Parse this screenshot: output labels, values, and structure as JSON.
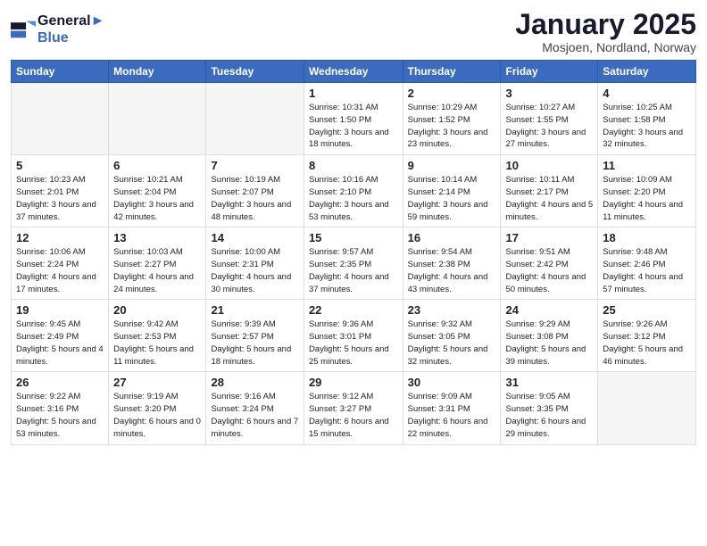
{
  "header": {
    "logo_line1": "General",
    "logo_line2": "Blue",
    "month": "January 2025",
    "location": "Mosjoen, Nordland, Norway"
  },
  "days_of_week": [
    "Sunday",
    "Monday",
    "Tuesday",
    "Wednesday",
    "Thursday",
    "Friday",
    "Saturday"
  ],
  "weeks": [
    [
      {
        "day": "",
        "empty": true
      },
      {
        "day": "",
        "empty": true
      },
      {
        "day": "",
        "empty": true
      },
      {
        "day": "1",
        "sunrise": "10:31 AM",
        "sunset": "1:50 PM",
        "daylight": "3 hours and 18 minutes."
      },
      {
        "day": "2",
        "sunrise": "10:29 AM",
        "sunset": "1:52 PM",
        "daylight": "3 hours and 23 minutes."
      },
      {
        "day": "3",
        "sunrise": "10:27 AM",
        "sunset": "1:55 PM",
        "daylight": "3 hours and 27 minutes."
      },
      {
        "day": "4",
        "sunrise": "10:25 AM",
        "sunset": "1:58 PM",
        "daylight": "3 hours and 32 minutes."
      }
    ],
    [
      {
        "day": "5",
        "sunrise": "10:23 AM",
        "sunset": "2:01 PM",
        "daylight": "3 hours and 37 minutes."
      },
      {
        "day": "6",
        "sunrise": "10:21 AM",
        "sunset": "2:04 PM",
        "daylight": "3 hours and 42 minutes."
      },
      {
        "day": "7",
        "sunrise": "10:19 AM",
        "sunset": "2:07 PM",
        "daylight": "3 hours and 48 minutes."
      },
      {
        "day": "8",
        "sunrise": "10:16 AM",
        "sunset": "2:10 PM",
        "daylight": "3 hours and 53 minutes."
      },
      {
        "day": "9",
        "sunrise": "10:14 AM",
        "sunset": "2:14 PM",
        "daylight": "3 hours and 59 minutes."
      },
      {
        "day": "10",
        "sunrise": "10:11 AM",
        "sunset": "2:17 PM",
        "daylight": "4 hours and 5 minutes."
      },
      {
        "day": "11",
        "sunrise": "10:09 AM",
        "sunset": "2:20 PM",
        "daylight": "4 hours and 11 minutes."
      }
    ],
    [
      {
        "day": "12",
        "sunrise": "10:06 AM",
        "sunset": "2:24 PM",
        "daylight": "4 hours and 17 minutes."
      },
      {
        "day": "13",
        "sunrise": "10:03 AM",
        "sunset": "2:27 PM",
        "daylight": "4 hours and 24 minutes."
      },
      {
        "day": "14",
        "sunrise": "10:00 AM",
        "sunset": "2:31 PM",
        "daylight": "4 hours and 30 minutes."
      },
      {
        "day": "15",
        "sunrise": "9:57 AM",
        "sunset": "2:35 PM",
        "daylight": "4 hours and 37 minutes."
      },
      {
        "day": "16",
        "sunrise": "9:54 AM",
        "sunset": "2:38 PM",
        "daylight": "4 hours and 43 minutes."
      },
      {
        "day": "17",
        "sunrise": "9:51 AM",
        "sunset": "2:42 PM",
        "daylight": "4 hours and 50 minutes."
      },
      {
        "day": "18",
        "sunrise": "9:48 AM",
        "sunset": "2:46 PM",
        "daylight": "4 hours and 57 minutes."
      }
    ],
    [
      {
        "day": "19",
        "sunrise": "9:45 AM",
        "sunset": "2:49 PM",
        "daylight": "5 hours and 4 minutes."
      },
      {
        "day": "20",
        "sunrise": "9:42 AM",
        "sunset": "2:53 PM",
        "daylight": "5 hours and 11 minutes."
      },
      {
        "day": "21",
        "sunrise": "9:39 AM",
        "sunset": "2:57 PM",
        "daylight": "5 hours and 18 minutes."
      },
      {
        "day": "22",
        "sunrise": "9:36 AM",
        "sunset": "3:01 PM",
        "daylight": "5 hours and 25 minutes."
      },
      {
        "day": "23",
        "sunrise": "9:32 AM",
        "sunset": "3:05 PM",
        "daylight": "5 hours and 32 minutes."
      },
      {
        "day": "24",
        "sunrise": "9:29 AM",
        "sunset": "3:08 PM",
        "daylight": "5 hours and 39 minutes."
      },
      {
        "day": "25",
        "sunrise": "9:26 AM",
        "sunset": "3:12 PM",
        "daylight": "5 hours and 46 minutes."
      }
    ],
    [
      {
        "day": "26",
        "sunrise": "9:22 AM",
        "sunset": "3:16 PM",
        "daylight": "5 hours and 53 minutes."
      },
      {
        "day": "27",
        "sunrise": "9:19 AM",
        "sunset": "3:20 PM",
        "daylight": "6 hours and 0 minutes."
      },
      {
        "day": "28",
        "sunrise": "9:16 AM",
        "sunset": "3:24 PM",
        "daylight": "6 hours and 7 minutes."
      },
      {
        "day": "29",
        "sunrise": "9:12 AM",
        "sunset": "3:27 PM",
        "daylight": "6 hours and 15 minutes."
      },
      {
        "day": "30",
        "sunrise": "9:09 AM",
        "sunset": "3:31 PM",
        "daylight": "6 hours and 22 minutes."
      },
      {
        "day": "31",
        "sunrise": "9:05 AM",
        "sunset": "3:35 PM",
        "daylight": "6 hours and 29 minutes."
      },
      {
        "day": "",
        "empty": true
      }
    ]
  ],
  "labels": {
    "sunrise_prefix": "Sunrise: ",
    "sunset_prefix": "Sunset: ",
    "daylight_prefix": "Daylight: "
  }
}
